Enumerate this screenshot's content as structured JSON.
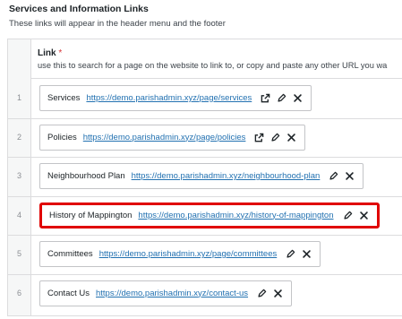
{
  "section": {
    "title": "Services and Information Links",
    "subtitle": "These links will appear in the header menu and the footer"
  },
  "table": {
    "column_label": "Link",
    "required_mark": "*",
    "column_help": "use this to search for a page on the website to link to, or copy and paste any other URL you wa",
    "rows": [
      {
        "index": "1",
        "name": "Services",
        "url": "https://demo.parishadmin.xyz/page/services",
        "external": true,
        "highlighted": false
      },
      {
        "index": "2",
        "name": "Policies",
        "url": "https://demo.parishadmin.xyz/page/policies",
        "external": true,
        "highlighted": false
      },
      {
        "index": "3",
        "name": "Neighbourhood Plan",
        "url": "https://demo.parishadmin.xyz/neighbourhood-plan",
        "external": false,
        "highlighted": false
      },
      {
        "index": "4",
        "name": "History of Mappington",
        "url": "https://demo.parishadmin.xyz/history-of-mappington",
        "external": false,
        "highlighted": true
      },
      {
        "index": "5",
        "name": "Committees",
        "url": "https://demo.parishadmin.xyz/page/committees",
        "external": false,
        "highlighted": false
      },
      {
        "index": "6",
        "name": "Contact Us",
        "url": "https://demo.parishadmin.xyz/contact-us",
        "external": false,
        "highlighted": false
      }
    ]
  },
  "icons": {
    "external": "external-link-icon",
    "edit": "pencil-icon",
    "remove": "close-icon"
  },
  "colors": {
    "link": "#2271b1",
    "highlight": "#e00000",
    "required": "#d63638"
  }
}
